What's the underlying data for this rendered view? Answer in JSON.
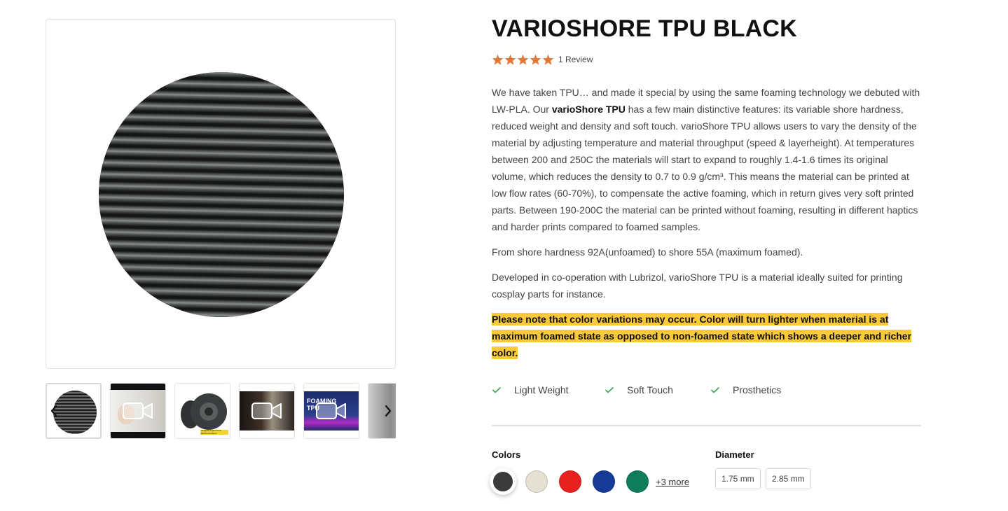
{
  "product": {
    "title": "VARIOSHORE TPU BLACK",
    "rating": {
      "stars": 5,
      "max": 5,
      "review_text": "1 Review",
      "star_color": "#e07a3a"
    }
  },
  "description": {
    "p1_start": "We have taken TPU… and made it special by using the same foaming technology we debuted with LW-PLA. Our ",
    "p1_bold": "varioShore TPU",
    "p1_end": " has a few main distinctive features: its variable shore hardness, reduced weight and density and soft touch. varioShore TPU allows users to vary the density of the material by adjusting temperature and material throughput (speed & layerheight). At temperatures between 200 and 250C the materials will start to expand to roughly 1.4-1.6 times its original volume, which reduces the density to 0.7 to 0.9 g/cm³. This means the material can be printed at low flow rates (60-70%), to compensate the active foaming, which in return gives very soft printed parts. Between 190-200C the material can be printed without foaming, resulting in different haptics and harder prints compared to foamed samples.",
    "p2": "From shore hardness 92A(unfoamed) to shore 55A (maximum foamed).",
    "p3": "Developed in co-operation with Lubrizol, varioShore TPU is a material ideally suited for printing cosplay parts for instance.",
    "note": "Please note that color variations may occur. Color will turn lighter when material is at maximum foamed state as opposed to non-foamed state which shows a deeper and richer color.",
    "note_color": "#f9c93a"
  },
  "features": [
    {
      "label": "Light Weight",
      "icon": "check-icon"
    },
    {
      "label": "Soft Touch",
      "icon": "check-icon"
    },
    {
      "label": "Prosthetics",
      "icon": "check-icon"
    }
  ],
  "colors": {
    "label": "Colors",
    "swatches": [
      {
        "name": "black",
        "hex": "#3a3b3b",
        "selected": true
      },
      {
        "name": "natural",
        "hex": "#e6e0d3",
        "selected": false
      },
      {
        "name": "red",
        "hex": "#e8201e",
        "selected": false
      },
      {
        "name": "blue",
        "hex": "#173a96",
        "selected": false
      },
      {
        "name": "green",
        "hex": "#0f7c5c",
        "selected": false
      }
    ],
    "more_text": "+3 more"
  },
  "diameter": {
    "label": "Diameter",
    "options": [
      "1.75 mm",
      "2.85 mm"
    ]
  },
  "gallery": {
    "thumbnails": [
      {
        "kind": "image",
        "subject": "filament-spool-closeup"
      },
      {
        "kind": "video"
      },
      {
        "kind": "image",
        "subject": "printed-tire-sample"
      },
      {
        "kind": "video"
      },
      {
        "kind": "video",
        "overlay_text": "FOAMING\nTPU"
      },
      {
        "kind": "image",
        "subject": "partial"
      }
    ],
    "thumb3_caption": "designed & printed by @drmonmetamo"
  },
  "icons": {
    "prev": "chevron-left-icon",
    "next": "chevron-right-icon",
    "video": "video-camera-icon",
    "star": "star-icon",
    "check": "check-icon"
  }
}
